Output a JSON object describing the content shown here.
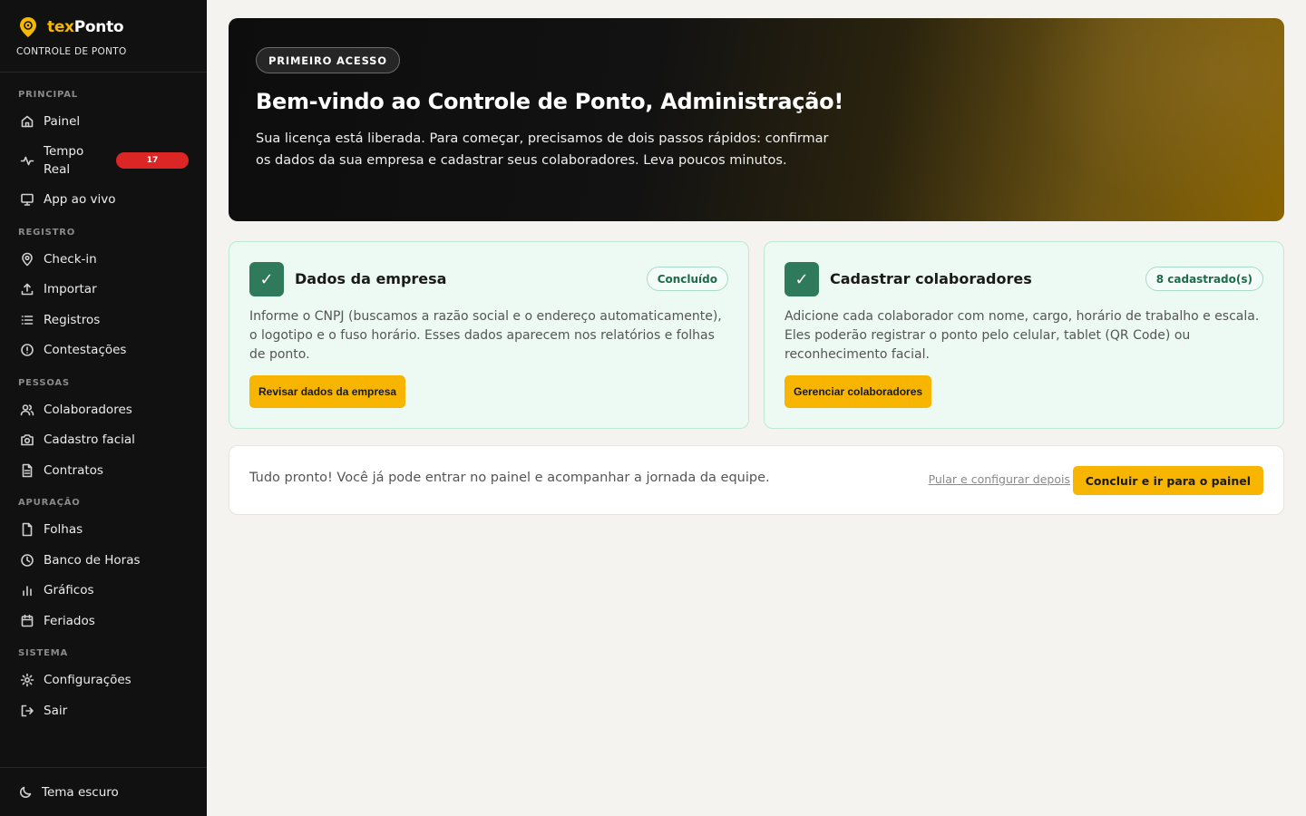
{
  "brand": {
    "name_prefix": "tex",
    "name_suffix": "Ponto",
    "subtitle": "CONTROLE DE PONTO",
    "logo_icon": "location-pin-icon"
  },
  "sidebar": {
    "sections": [
      {
        "label": "PRINCIPAL"
      },
      {
        "label": "REGISTRO"
      },
      {
        "label": "PESSOAS"
      },
      {
        "label": "APURAÇÃO"
      },
      {
        "label": "SISTEMA"
      }
    ],
    "items": [
      {
        "label": "Painel",
        "icon": "home-icon"
      },
      {
        "label": "Tempo Real",
        "icon": "activity-icon",
        "badge": "17"
      },
      {
        "label": "App ao vivo",
        "icon": "monitor-icon"
      },
      {
        "label": "Check-in",
        "icon": "map-pin-icon"
      },
      {
        "label": "Importar",
        "icon": "upload-icon"
      },
      {
        "label": "Registros",
        "icon": "list-icon"
      },
      {
        "label": "Contestações",
        "icon": "alert-circle-icon"
      },
      {
        "label": "Colaboradores",
        "icon": "users-icon"
      },
      {
        "label": "Cadastro facial",
        "icon": "camera-icon"
      },
      {
        "label": "Contratos",
        "icon": "file-text-icon"
      },
      {
        "label": "Folhas",
        "icon": "file-icon"
      },
      {
        "label": "Banco de Horas",
        "icon": "clock-icon"
      },
      {
        "label": "Gráficos",
        "icon": "bar-chart-icon"
      },
      {
        "label": "Feriados",
        "icon": "calendar-icon"
      },
      {
        "label": "Configurações",
        "icon": "settings-icon"
      },
      {
        "label": "Sair",
        "icon": "logout-icon"
      }
    ],
    "footer": {
      "label": "Tema escuro",
      "icon": "moon-icon"
    }
  },
  "hero": {
    "pill": "PRIMEIRO ACESSO",
    "title": "Bem-vindo ao Controle de Ponto, Administração!",
    "text": "Sua licença está liberada. Para começar, precisamos de dois passos rápidos: confirmar os dados da sua empresa e cadastrar seus colaboradores. Leva poucos minutos."
  },
  "cards": [
    {
      "title": "Dados da empresa",
      "status": "Concluído",
      "text": "Informe o CNPJ (buscamos a razão social e o endereço automaticamente), o logotipo e o fuso horário. Esses dados aparecem nos relatórios e folhas de ponto.",
      "button": "Revisar dados da empresa",
      "check": "✓"
    },
    {
      "title": "Cadastrar colaboradores",
      "status": "8 cadastrado(s)",
      "text": "Adicione cada colaborador com nome, cargo, horário de trabalho e escala. Eles poderão registrar o ponto pelo celular, tablet (QR Code) ou reconhecimento facial.",
      "button": "Gerenciar colaboradores",
      "check": "✓"
    }
  ],
  "footer_bar": {
    "text": "Tudo pronto! Você já pode entrar no painel e acompanhar a jornada da equipe.",
    "skip_link": "Pular e configurar depois",
    "finish_button": "Concluir e ir para o painel"
  },
  "colors": {
    "accent": "#f7b500",
    "sidebar_bg": "#111111",
    "success": "#2f7a5a",
    "badge": "#dc2626"
  }
}
